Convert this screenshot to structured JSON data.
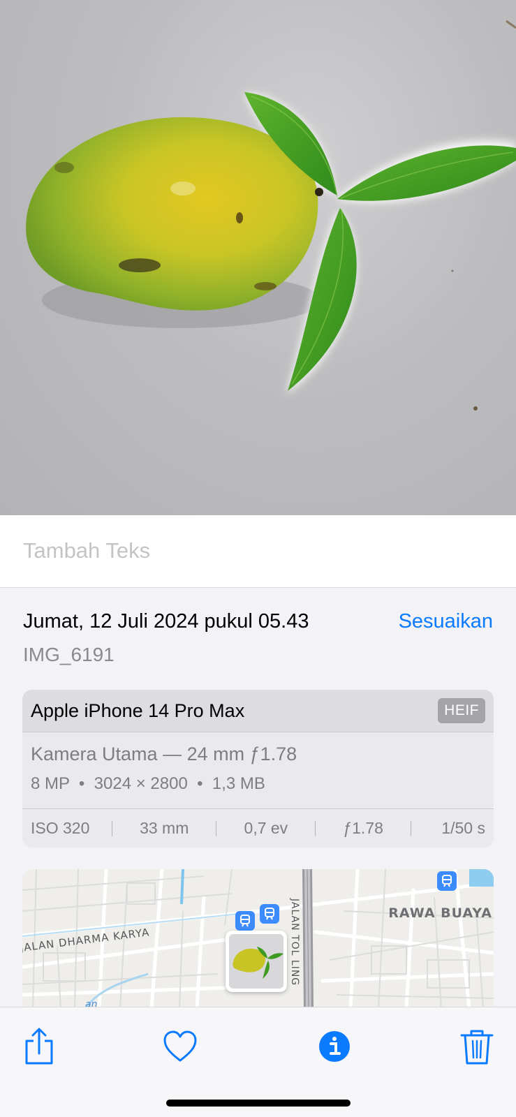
{
  "caption": {
    "placeholder": "Tambah Teks"
  },
  "info": {
    "date_time": "Jumat, 12 Juli 2024 pukul 05.43",
    "adjust_label": "Sesuaikan",
    "filename": "IMG_6191"
  },
  "metadata": {
    "device": "Apple iPhone 14 Pro Max",
    "format": "HEIF",
    "lens": "Kamera Utama — 24 mm ƒ1.78",
    "specs": "8 MP  •  3024 × 2800  •  1,3 MB",
    "exif": {
      "iso": "ISO 320",
      "focal_length": "33 mm",
      "exposure": "0,7 ev",
      "aperture": "ƒ1.78",
      "shutter": "1/50 s"
    }
  },
  "map": {
    "labels": {
      "district": "RAWA BUAYA",
      "street": "JALAN DHARMA KARYA",
      "highway": "JALAN TOL LING"
    }
  },
  "toolbar": {
    "icons": [
      "share-icon",
      "heart-icon",
      "info-icon",
      "trash-icon"
    ],
    "accent_color": "#0a7aff"
  }
}
